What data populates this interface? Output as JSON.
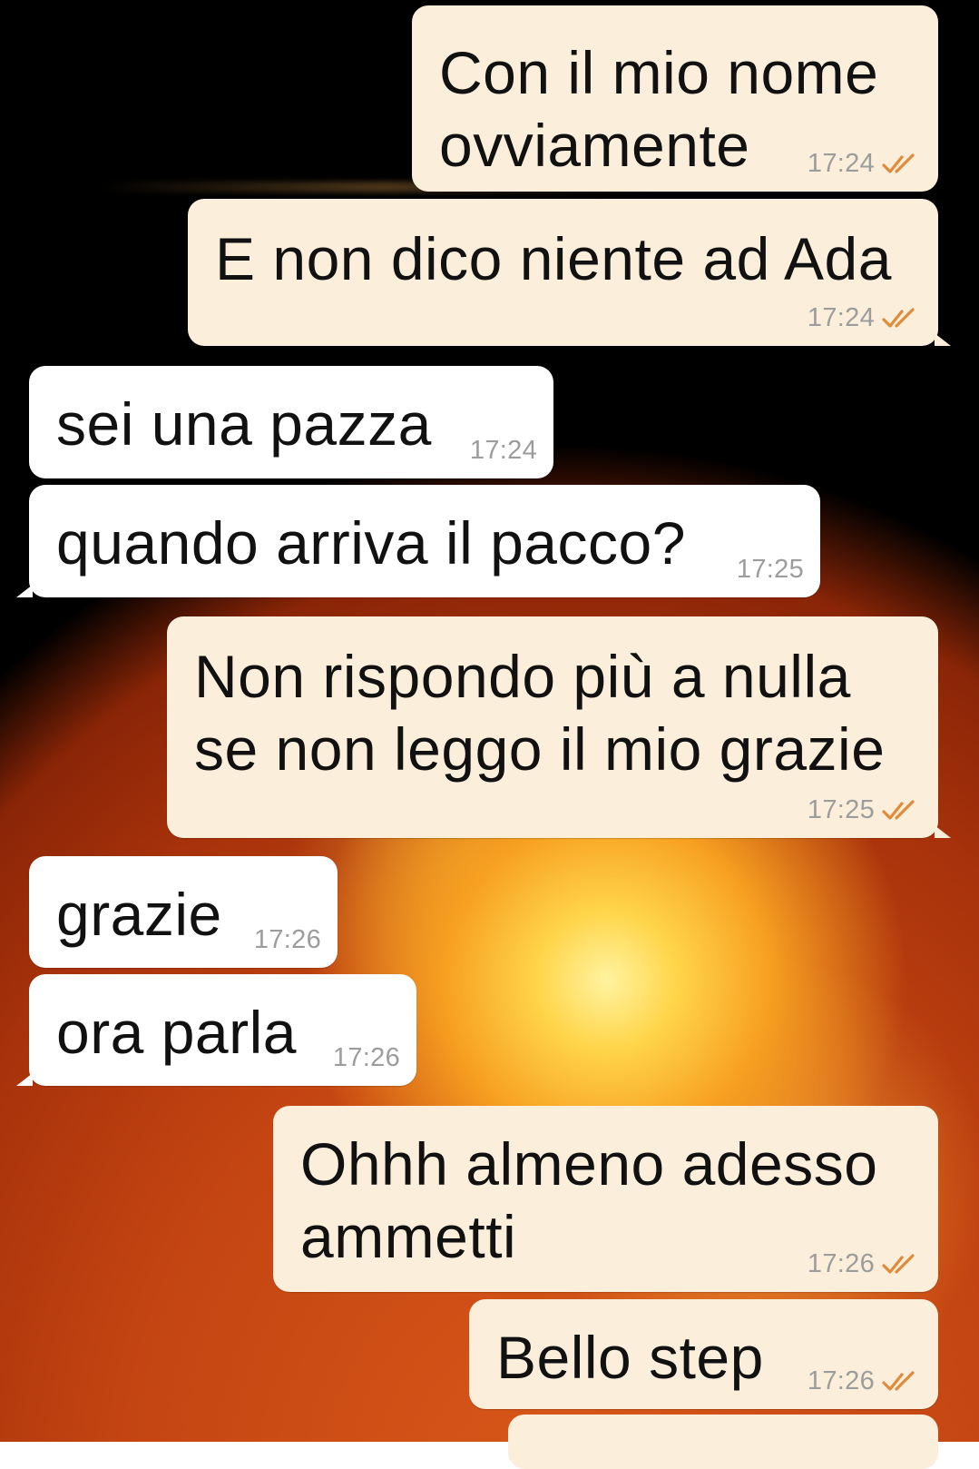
{
  "chat": {
    "messages": [
      {
        "direction": "outgoing",
        "text_lines": [
          "Con il mio nome",
          "ovviamente"
        ],
        "time": "17:24",
        "status": "read"
      },
      {
        "direction": "outgoing",
        "text_lines": [
          "E non dico niente ad Ada"
        ],
        "time": "17:24",
        "status": "read"
      },
      {
        "direction": "incoming",
        "text_lines": [
          "sei una pazza"
        ],
        "time": "17:24"
      },
      {
        "direction": "incoming",
        "text_lines": [
          "quando arriva il pacco?"
        ],
        "time": "17:25"
      },
      {
        "direction": "outgoing",
        "text_lines": [
          "Non rispondo più a nulla",
          "se non leggo il mio grazie"
        ],
        "time": "17:25",
        "status": "read"
      },
      {
        "direction": "incoming",
        "text_lines": [
          "grazie"
        ],
        "time": "17:26"
      },
      {
        "direction": "incoming",
        "text_lines": [
          "ora parla"
        ],
        "time": "17:26"
      },
      {
        "direction": "outgoing",
        "text_lines": [
          "Ohhh almeno adesso",
          "ammetti"
        ],
        "time": "17:26",
        "status": "read"
      },
      {
        "direction": "outgoing",
        "text_lines": [
          "Bello step"
        ],
        "time": "17:26",
        "status": "read"
      }
    ],
    "read_icon": "double-check-icon"
  },
  "colors": {
    "outgoing_bubble": "#fbefdc",
    "incoming_bubble": "#ffffff",
    "timestamp": "#9c9c9c",
    "read_ticks": "#e08a3a"
  }
}
